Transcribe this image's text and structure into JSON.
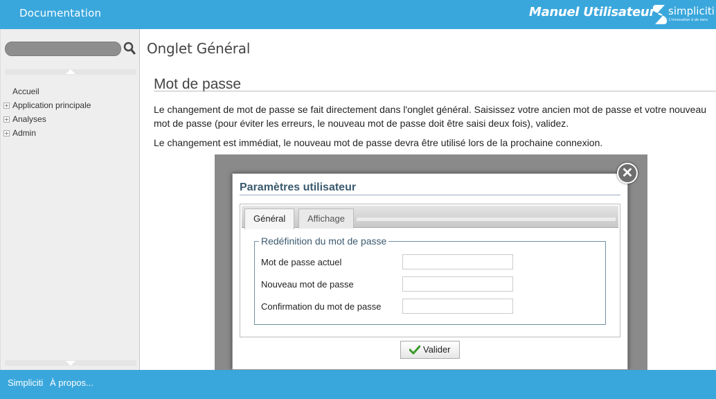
{
  "header": {
    "doc_title": "Documentation",
    "manual_title": "Manuel Utilisateur",
    "logo_name": "simpliciti",
    "logo_tagline": "L'innovation à de sens",
    "accent_color": "#3aa7dc"
  },
  "sidebar": {
    "search_placeholder": "",
    "tree": [
      {
        "label": "Accueil",
        "expandable": false
      },
      {
        "label": "Application principale",
        "expandable": true
      },
      {
        "label": "Analyses",
        "expandable": true
      },
      {
        "label": "Admin",
        "expandable": true
      }
    ]
  },
  "main": {
    "page_title": "Onglet Général",
    "section_title": "Mot de passe",
    "paragraph1": "Le changement de mot de passe se fait directement dans l'onglet général. Saisissez votre ancien mot de passe et votre nouveau mot de passe (pour éviter les erreurs, le nouveau mot de passe doit être saisi deux fois), validez.",
    "paragraph2": "Le changement est immédiat, le nouveau mot de passe devra être utilisé lors de la prochaine connexion."
  },
  "dialog": {
    "title": "Paramètres utilisateur",
    "close_glyph": "✕",
    "tabs": [
      {
        "label": "Général",
        "active": true
      },
      {
        "label": "Affichage",
        "active": false
      }
    ],
    "fieldset_legend": "Redéfinition du mot de passe",
    "fields": [
      {
        "label": "Mot de passe actuel",
        "value": ""
      },
      {
        "label": "Nouveau mot de passe",
        "value": ""
      },
      {
        "label": "Confirmation du mot de passe",
        "value": ""
      }
    ],
    "submit_label": "Valider"
  },
  "footer": {
    "links": [
      "Simpliciti",
      "À propos..."
    ]
  }
}
